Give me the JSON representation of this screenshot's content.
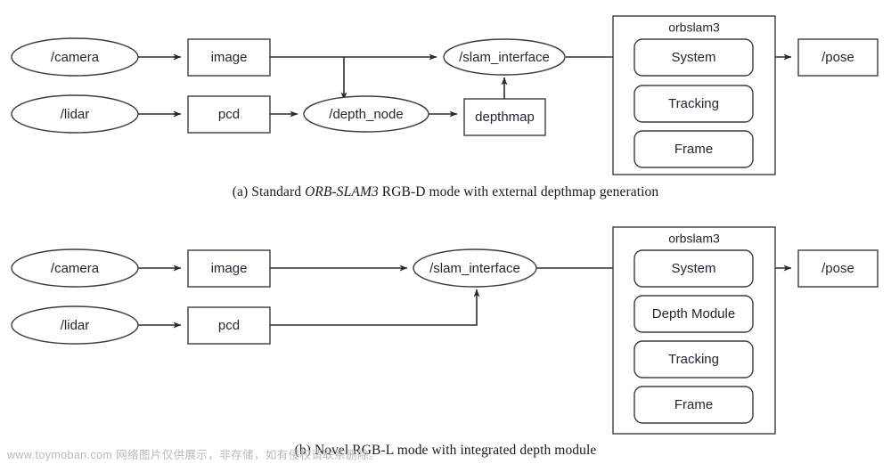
{
  "figure": {
    "subfigures": [
      {
        "id": "a",
        "caption_prefix": "(a) Standard ",
        "caption_emphasis": "ORB-SLAM3",
        "caption_suffix": " RGB-D mode with external depthmap generation",
        "nodes": {
          "camera": "/camera",
          "image": "image",
          "lidar": "/lidar",
          "pcd": "pcd",
          "depth_node": "/depth_node",
          "depthmap": "depthmap",
          "slam_interface": "/slam_interface",
          "pose": "/pose"
        },
        "container": {
          "title": "orbslam3",
          "modules": [
            "System",
            "Tracking",
            "Frame"
          ]
        }
      },
      {
        "id": "b",
        "caption_prefix": "(b) Novel RGB-L mode with integrated depth module",
        "caption_emphasis": "",
        "caption_suffix": "",
        "nodes": {
          "camera": "/camera",
          "image": "image",
          "lidar": "/lidar",
          "pcd": "pcd",
          "slam_interface": "/slam_interface",
          "pose": "/pose"
        },
        "container": {
          "title": "orbslam3",
          "modules": [
            "System",
            "Depth Module",
            "Tracking",
            "Frame"
          ]
        }
      }
    ]
  },
  "watermark": {
    "text": "www.toymoban.com 网络图片仅供展示，非存储，如有侵权请联系删除。"
  },
  "colors": {
    "stroke": "#3c3c3c",
    "edge": "#2b2b2b",
    "text": "#1f2430",
    "background": "#ffffff",
    "watermark": "#b9b9b9"
  }
}
